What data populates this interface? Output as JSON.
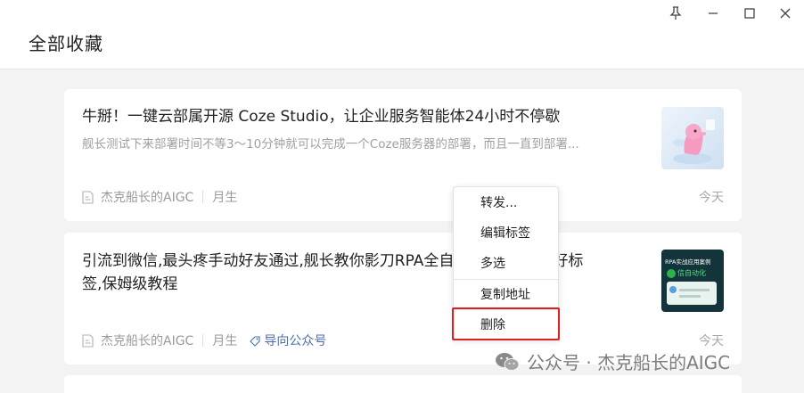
{
  "window": {
    "title": "全部收藏"
  },
  "cards": [
    {
      "title": "牛掰！一键云部属开源 Coze Studio，让企业服务智能体24小时不停歇",
      "summary": "舰长测试下来部署时间不等3～10分钟就可以完成一个Coze服务器的部署，而且一直到部署...",
      "author": "杰克船长的AIGC",
      "source": "月生",
      "date": "今天"
    },
    {
      "title": "引流到微信,最头疼手动好友通过,舰长教你影刀RPA全自动通过并打好标签,保姆级教程",
      "title_line1": "引流到微信,最头疼手动好友通过,舰长教你影刀RPA全自",
      "title_line1_tail": "过并打好标",
      "title_line2": "签,保姆级教程",
      "author": "杰克船长的AIGC",
      "source": "月生",
      "tag": "导向公众号",
      "date": "今天",
      "thumb_text_1": "RPA实战应用案例",
      "thumb_text_2": "信自动化"
    }
  ],
  "context_menu": {
    "items": [
      "转发...",
      "编辑标签",
      "多选",
      "复制地址",
      "删除"
    ]
  },
  "watermark": {
    "text": "公众号 · 杰克船长的AIGC"
  },
  "colors": {
    "highlight_border": "#e02020",
    "tag_color": "#4c6ea8"
  },
  "icons": [
    "pin-icon",
    "minimize-icon",
    "maximize-icon",
    "close-icon",
    "document-icon",
    "tag-icon",
    "wechat-icon"
  ]
}
